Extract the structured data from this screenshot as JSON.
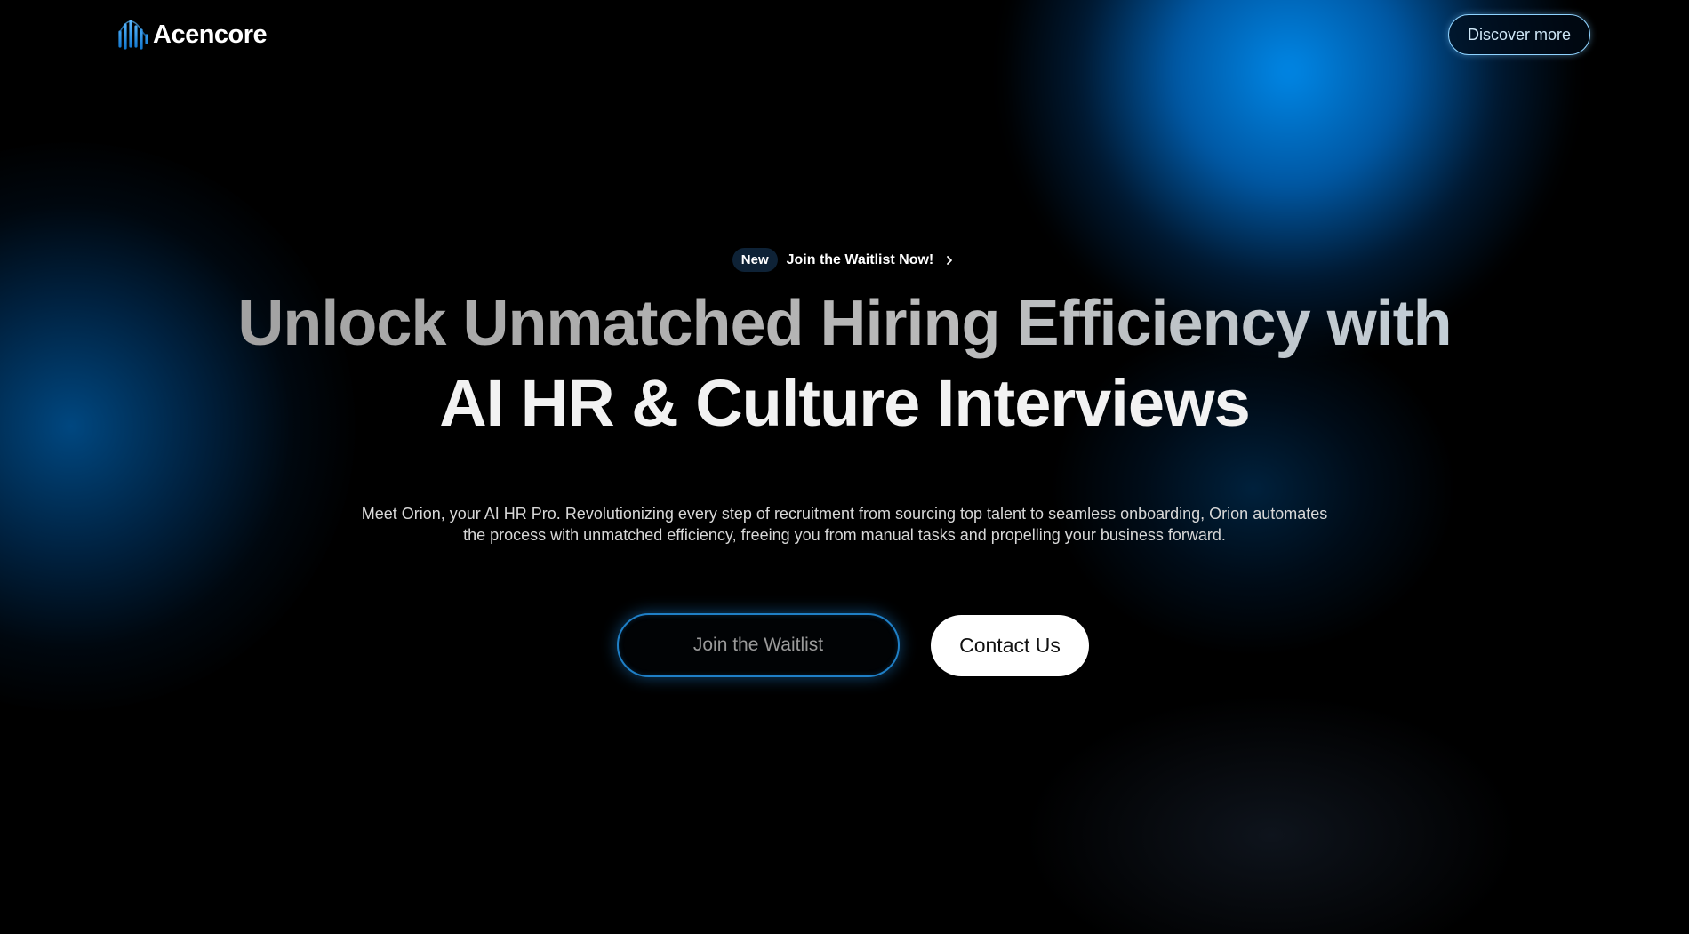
{
  "brand": {
    "name": "Acencore",
    "logo_icon": "wave-bars-logo-icon",
    "accent_color": "#1e88d8"
  },
  "header": {
    "discover_label": "Discover more"
  },
  "announcement": {
    "badge": "New",
    "text": "Join the Waitlist Now!",
    "icon": "chevron-right-icon"
  },
  "hero": {
    "headline_line1": "Unlock Unmatched Hiring Efficiency with",
    "headline_line2": "AI HR & Culture Interviews",
    "subtitle_line1": "Meet Orion, your AI HR Pro. Revolutionizing every step of recruitment from sourcing top talent to seamless onboarding, Orion automates",
    "subtitle_line2": "the process with unmatched efficiency, freeing you from manual tasks and propelling your business forward."
  },
  "cta": {
    "primary_label": "Join the Waitlist",
    "secondary_label": "Contact Us"
  }
}
